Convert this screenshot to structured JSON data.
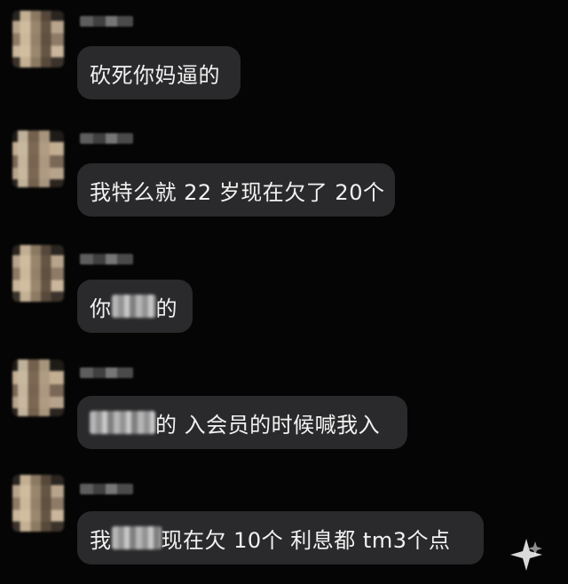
{
  "messages": [
    {
      "text_before": "砍死你妈逼的",
      "text_after": "",
      "redacted": false
    },
    {
      "text_before": "我特么就 22 岁现在欠了 20个",
      "text_after": "",
      "redacted": false
    },
    {
      "text_before": "你",
      "text_after": "的",
      "redacted": true
    },
    {
      "text_before": "",
      "text_after": "的 入会员的时候喊我入",
      "redacted": true
    },
    {
      "text_before": "我",
      "text_after": "现在欠 10个 利息都 tm3个点",
      "redacted": true
    }
  ],
  "icons": {
    "watermark": "sparkle-logo-icon"
  }
}
